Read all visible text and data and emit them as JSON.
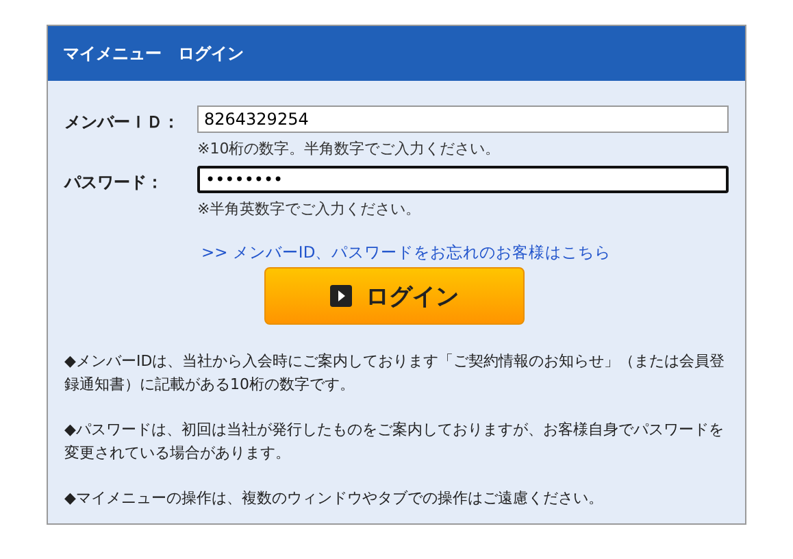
{
  "panel": {
    "title": "マイメニュー　ログイン"
  },
  "fields": [
    {
      "label": "メンバーＩＤ：",
      "value": "8264329254",
      "focused": false,
      "hint": "※10桁の数字。半角数字でご入力ください。"
    },
    {
      "label": "パスワード：",
      "value": "••••••••",
      "focused": true,
      "hint": "※半角英数字でご入力ください。"
    }
  ],
  "forgot_link": ">> メンバーID、パスワードをお忘れのお客様はこちら",
  "login_button": "ログイン",
  "notes": [
    "◆メンバーIDは、当社から入会時にご案内しております「ご契約情報のお知らせ」（または会員登録通知書）に記載がある10桁の数字です。",
    "◆パスワードは、初回は当社が発行したものをご案内しておりますが、お客様自身でパスワードを変更されている場合があります。",
    "◆マイメニューの操作は、複数のウィンドウやタブでの操作はご遠慮ください。"
  ]
}
